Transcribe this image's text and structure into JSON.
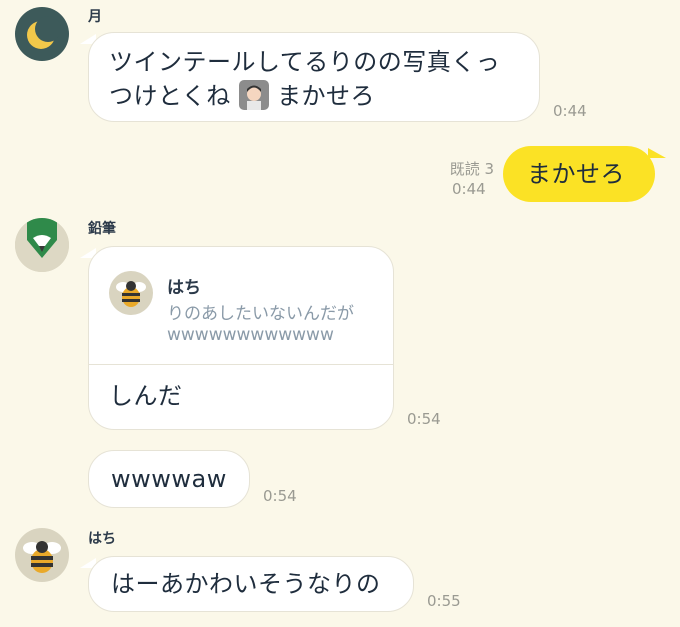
{
  "messages": [
    {
      "sender": "月",
      "lines": [
        "ツインテールしてるりのの写真くっ",
        "つけとくね",
        "まかせろ"
      ],
      "emoji": "person-gesturing-ok",
      "time": "0:44"
    },
    {
      "self": true,
      "text": "まかせろ",
      "read_label": "既読 3",
      "time": "0:44"
    },
    {
      "sender": "鉛筆",
      "quote": {
        "name": "はち",
        "line1": "りのあしたいないんだが",
        "line2": "wwwwwwwwwwww"
      },
      "text": "しんだ",
      "time": "0:54"
    },
    {
      "text": "wwwwaw",
      "time": "0:54"
    },
    {
      "sender": "はち",
      "text": "はーあかわいそうなりの",
      "time": "0:55"
    }
  ],
  "colors": {
    "background": "#fbf8e9",
    "self_bubble": "#fbe225",
    "moon_avatar_bg": "#3d5a5a",
    "pencil_green": "#2f8a4a",
    "bee_yellow": "#e9a92a"
  }
}
